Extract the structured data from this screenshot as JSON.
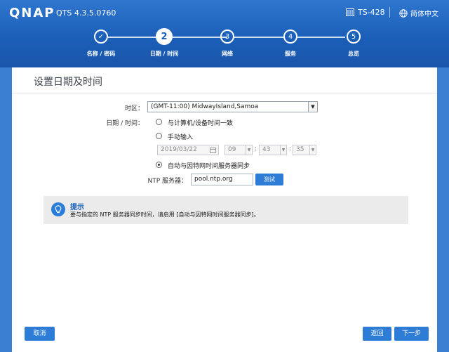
{
  "header": {
    "logo": "QNAP",
    "version": "QTS 4.3.5.0760",
    "model": "TS-428",
    "language": "简体中文"
  },
  "steps": [
    {
      "number": "✓",
      "label": "名称 / 密码",
      "state": "done"
    },
    {
      "number": "2",
      "label": "日期 / 时间",
      "state": "active"
    },
    {
      "number": "3",
      "label": "网络",
      "state": "pending"
    },
    {
      "number": "4",
      "label": "服务",
      "state": "pending"
    },
    {
      "number": "5",
      "label": "总览",
      "state": "pending"
    }
  ],
  "page": {
    "title": "设置日期及时间",
    "timezone_label": "时区：",
    "timezone_value": "(GMT-11:00) MidwayIsland,Samoa",
    "datetime_label": "日期 / 时间：",
    "options": {
      "sync_computer": "与计算机/设备时间一致",
      "manual": "手动输入",
      "ntp": "自动与因特网时间服务器同步"
    },
    "selected_option": "ntp",
    "manual": {
      "date": "2019/03/22",
      "hour": "09",
      "minute": "43",
      "second": "35",
      "separator": ":"
    },
    "ntp_label": "NTP 服务器：",
    "ntp_value": "pool.ntp.org",
    "test_button": "测试"
  },
  "tip": {
    "title": "提示",
    "text": "要与指定的 NTP 服务器同步时间，请启用 [自动与因特网时间服务器同步]。"
  },
  "footer": {
    "cancel": "取消",
    "back": "返回",
    "next": "下一步"
  },
  "colors": {
    "header_blue": "#1b5fb8",
    "button_blue": "#2d7cd5"
  }
}
